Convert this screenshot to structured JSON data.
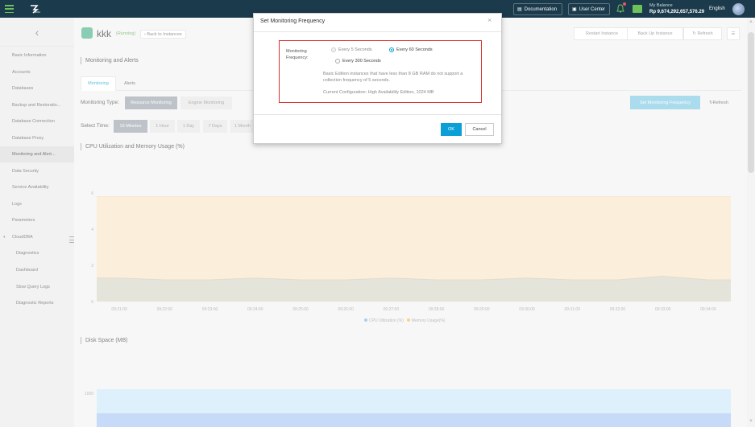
{
  "topbar": {
    "logo_text": "dou",
    "documentation": "Documentation",
    "user_center": "User Center",
    "balance_label": "My Balance",
    "balance_value": "Rp 9,674,292,657,576.29",
    "language": "English"
  },
  "sidebar": {
    "items": [
      {
        "label": "Basic Information"
      },
      {
        "label": "Accounts"
      },
      {
        "label": "Databases"
      },
      {
        "label": "Backup and Restoratio..."
      },
      {
        "label": "Database Connection"
      },
      {
        "label": "Database Proxy"
      },
      {
        "label": "Monitoring and Alert..."
      },
      {
        "label": "Data Security"
      },
      {
        "label": "Service Availability"
      },
      {
        "label": "Logs"
      },
      {
        "label": "Parameters"
      },
      {
        "label": "CloudDBA"
      },
      {
        "label": "Diagnostics"
      },
      {
        "label": "Dashboard"
      },
      {
        "label": "Slow Query Logs"
      },
      {
        "label": "Diagnostic Reports"
      }
    ]
  },
  "header": {
    "instance_name": "kkk",
    "status": "(Running)",
    "back_link": "Back to Instances",
    "restart": "Restart Instance",
    "backup": "Back Up Instance",
    "refresh": "Refresh"
  },
  "main": {
    "section_title": "Monitoring and Alerts",
    "tabs": [
      {
        "label": "Monitoring"
      },
      {
        "label": "Alerts"
      }
    ],
    "monitoring_type_label": "Monitoring Type:",
    "monitoring_types": [
      {
        "label": "Resource Monitoring"
      },
      {
        "label": "Engine Monitoring"
      }
    ],
    "select_time_label": "Select Time:",
    "times": [
      {
        "label": "15 Minutes"
      },
      {
        "label": "1 Hour"
      },
      {
        "label": "1 Day"
      },
      {
        "label": "7 Days"
      },
      {
        "label": "1 Month"
      }
    ],
    "set_freq_button": "Set Monitoring Frequency",
    "refresh_button": "Refresh",
    "disk_title": "Disk Space (MB)",
    "disk_tick": "1000"
  },
  "chart_data": {
    "type": "area",
    "title": "CPU Utilization and Memory Usage (%)",
    "x": [
      "09:21:00",
      "09:22:00",
      "09:23:00",
      "09:24:00",
      "09:25:00",
      "09:26:00",
      "09:27:00",
      "09:28:00",
      "09:29:00",
      "09:30:00",
      "09:31:00",
      "09:32:00",
      "09:33:00",
      "09:34:00"
    ],
    "ylim": [
      0,
      6
    ],
    "yticks": [
      "0",
      "2",
      "4",
      "6"
    ],
    "series": [
      {
        "name": "CPU Utilization (%)",
        "color": "#a8c8e8",
        "values": [
          1.3,
          1.2,
          1.2,
          1.3,
          1.2,
          1.2,
          1.3,
          1.2,
          1.2,
          1.3,
          1.2,
          1.2,
          1.4,
          1.2
        ]
      },
      {
        "name": "Memory Usage(%)",
        "color": "#f5c47a",
        "values": [
          5.8,
          5.8,
          5.8,
          5.8,
          5.8,
          5.8,
          5.8,
          5.8,
          5.8,
          5.8,
          5.8,
          5.8,
          5.8,
          5.8
        ]
      }
    ],
    "legend_position": "bottom-center"
  },
  "modal": {
    "title": "Set Monitoring Frequency",
    "frequency_label": "Monitoring Frequency:",
    "options": [
      {
        "label": "Every 5 Seconds",
        "checked": false,
        "disabled": true
      },
      {
        "label": "Every 60 Seconds",
        "checked": true,
        "disabled": false
      },
      {
        "label": "Every 300 Seconds",
        "checked": false,
        "disabled": false
      }
    ],
    "note": "Basic Edition instances that have less than 8 GB RAM do not support a collection frequency of 5 seconds.",
    "config": "Current Configuration: High Availability Edition, 1024 MB",
    "ok": "OK",
    "cancel": "Cancel"
  }
}
